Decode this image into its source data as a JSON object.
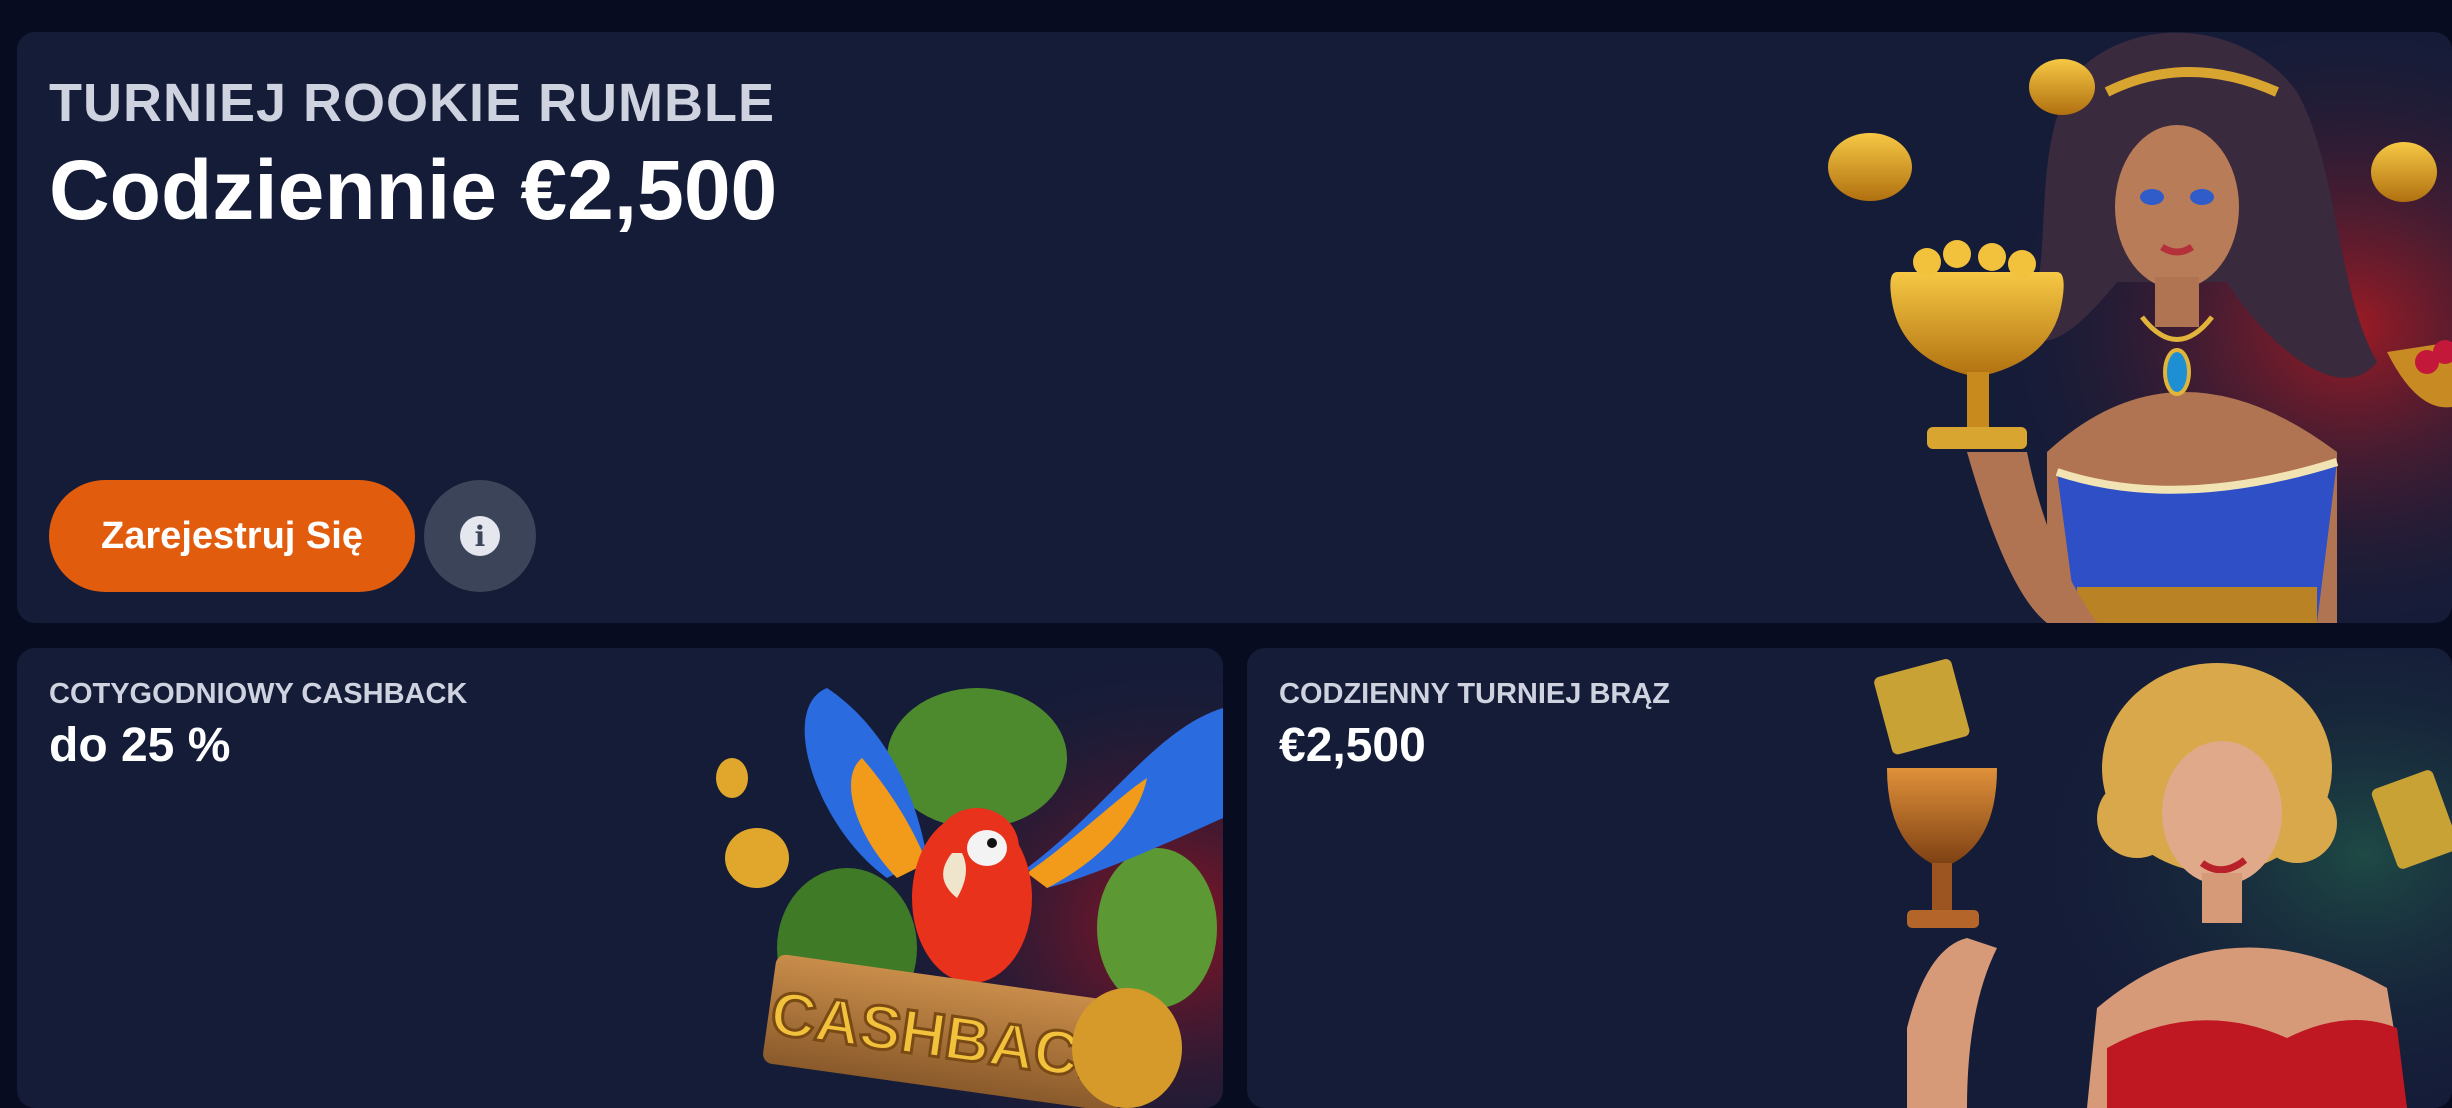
{
  "hero": {
    "kicker": "TURNIEJ ROOKIE RUMBLE",
    "title": "Codziennie €2,500",
    "register_label": "Zarejestruj Się",
    "info_glyph": "i",
    "art": "goddess-with-trophy-illustration"
  },
  "cashback": {
    "kicker": "COTYGODNIOWY CASHBACK",
    "title": "do 25 %",
    "art": "parrot-cashback-sign-illustration",
    "art_sign_text": "CASHBACK"
  },
  "bronze": {
    "kicker": "CODZIENNY TURNIEJ BRĄZ",
    "title": "€2,500",
    "art": "pinup-woman-with-bronze-trophy-illustration"
  },
  "colors": {
    "page_bg": "#070c21",
    "card_bg": "#151c38",
    "accent": "#e25c0d",
    "info_btn": "#3c4459"
  }
}
